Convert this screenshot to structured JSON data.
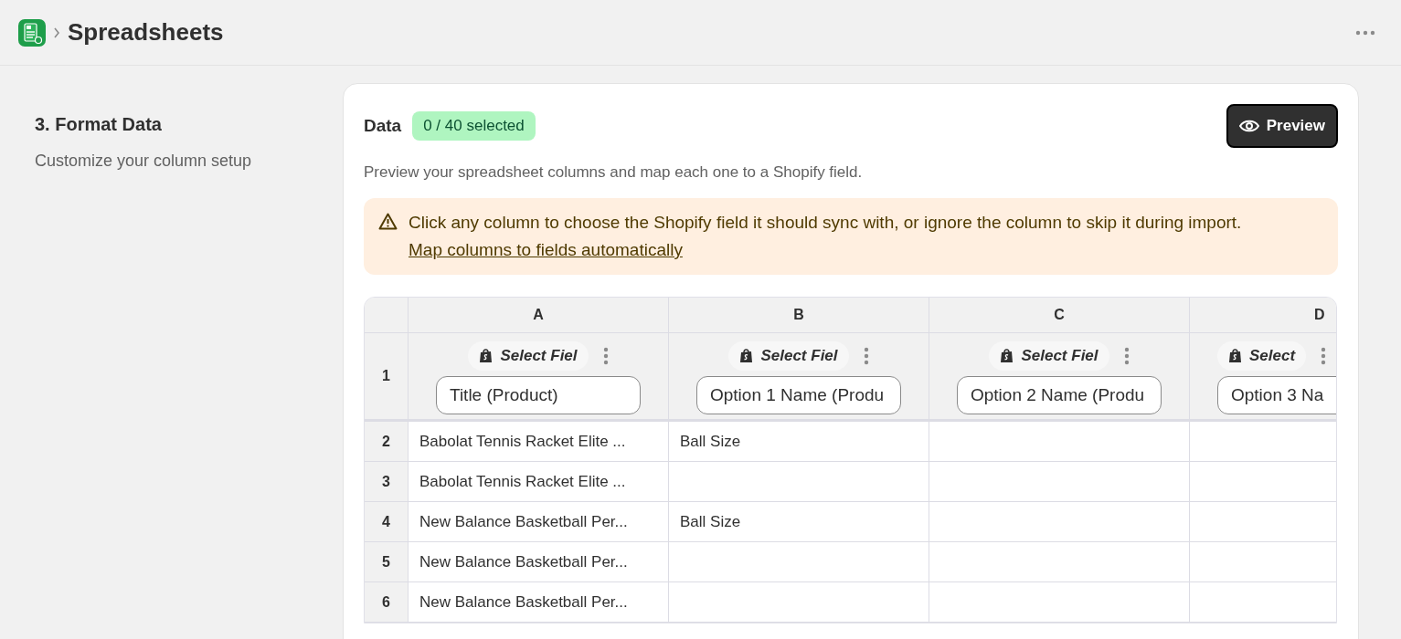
{
  "header": {
    "title": "Spreadsheets"
  },
  "step": {
    "title": "3. Format Data",
    "subtitle": "Customize your column setup"
  },
  "card": {
    "title": "Data",
    "badge": "0 / 40 selected",
    "preview_button": "Preview",
    "description": "Preview your spreadsheet columns and map each one to a Shopify field.",
    "banner": {
      "text": "Click any column to choose the Shopify field it should sync with, or ignore the column to skip it during import.",
      "link": "Map columns to fields automatically"
    }
  },
  "table": {
    "header_row": "1",
    "columns": [
      {
        "letter": "A",
        "field_button": "Select Fiel",
        "value": "Title (Product)"
      },
      {
        "letter": "B",
        "field_button": "Select Fiel",
        "value": "Option 1 Name (Produ"
      },
      {
        "letter": "C",
        "field_button": "Select Fiel",
        "value": "Option 2 Name (Produ"
      },
      {
        "letter": "D",
        "field_button": "Select",
        "value": "Option 3 Na"
      }
    ],
    "rows": [
      {
        "number": "2",
        "cells": [
          "Babolat Tennis Racket Elite ...",
          "Ball Size"
        ]
      },
      {
        "number": "3",
        "cells": [
          "Babolat Tennis Racket Elite ..."
        ]
      },
      {
        "number": "4",
        "cells": [
          "New Balance Basketball Per...",
          "Ball Size"
        ]
      },
      {
        "number": "5",
        "cells": [
          "New Balance Basketball Per..."
        ]
      },
      {
        "number": "6",
        "cells": [
          "New Balance Basketball Per..."
        ]
      }
    ]
  }
}
